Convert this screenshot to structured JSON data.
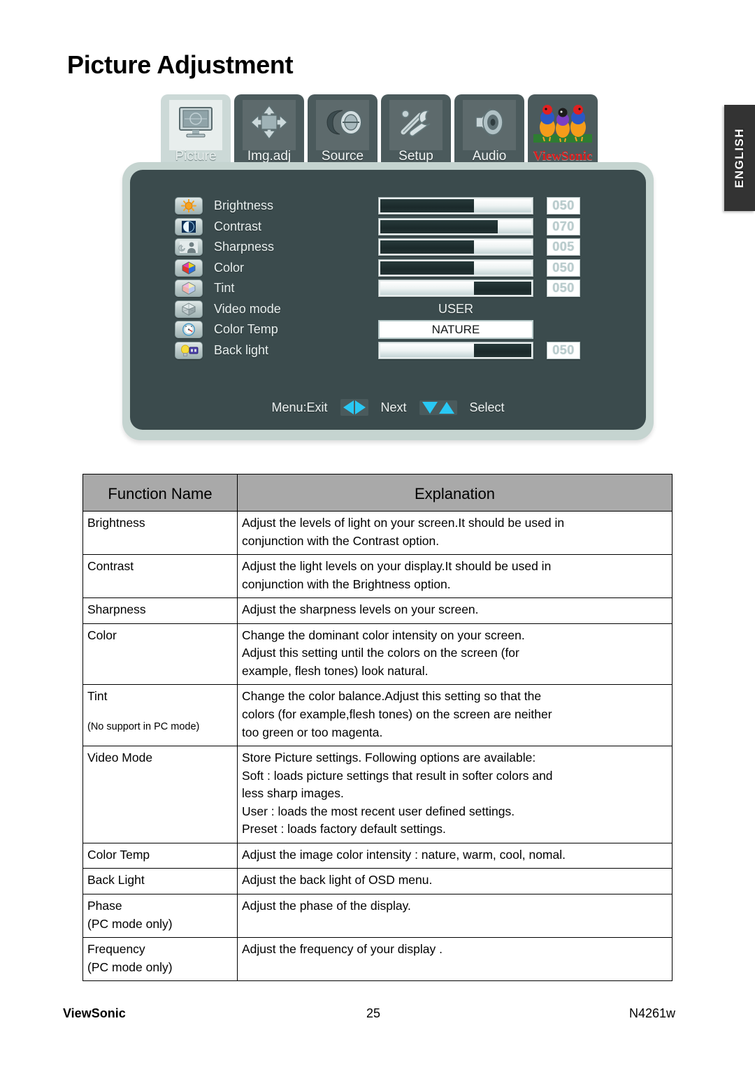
{
  "page": {
    "title": "Picture Adjustment",
    "language_tab": "ENGLISH"
  },
  "osd": {
    "tabs": [
      {
        "label": "Picture",
        "icon": "monitor-icon",
        "active": true
      },
      {
        "label": "Img.adj",
        "icon": "move-arrows-icon",
        "active": false
      },
      {
        "label": "Source",
        "icon": "input-source-icon",
        "active": false
      },
      {
        "label": "Setup",
        "icon": "tools-icon",
        "active": false
      },
      {
        "label": "Audio",
        "icon": "speaker-icon",
        "active": false
      },
      {
        "label": "ViewSonic",
        "icon": "viewsonic-birds-logo",
        "active": false
      }
    ],
    "rows": [
      {
        "label": "Brightness",
        "icon": "sun-icon",
        "value": "050",
        "fill": 62,
        "type": "slider-dark"
      },
      {
        "label": "Contrast",
        "icon": "contrast-icon",
        "value": "070",
        "fill": 78,
        "type": "slider-dark"
      },
      {
        "label": "Sharpness",
        "icon": "person-icon",
        "value": "005",
        "fill": 62,
        "type": "slider-dark"
      },
      {
        "label": "Color",
        "icon": "color-cube-icon",
        "value": "050",
        "fill": 62,
        "type": "slider-dark"
      },
      {
        "label": "Tint",
        "icon": "tint-cube-icon",
        "value": "050",
        "fill": 62,
        "type": "slider-light"
      },
      {
        "label": "Video mode",
        "icon": "gray-cube-icon",
        "value": "USER",
        "type": "text"
      },
      {
        "label": "Color Temp",
        "icon": "gauge-icon",
        "value": "NATURE",
        "type": "combo"
      },
      {
        "label": "Back light",
        "icon": "bulb-icon",
        "value": "050",
        "fill": 62,
        "type": "slider-light"
      }
    ],
    "footer": {
      "exit_label": "Menu:Exit",
      "next_label": "Next",
      "select_label": "Select",
      "lr_keys_icon": "left-right-arrow-keys",
      "ud_keys_icon": "up-down-arrow-keys"
    },
    "accent_color": "#29c8f4",
    "panel_color": "#3b4b4d",
    "shell_color": "#c5d4d0"
  },
  "table": {
    "headers": [
      "Function Name",
      "Explanation"
    ],
    "rows": [
      {
        "name": "Brightness",
        "note": "",
        "lines": [
          "Adjust the levels of light on your screen.It should be used in",
          "conjunction with the Contrast option."
        ]
      },
      {
        "name": "Contrast",
        "note": "",
        "lines": [
          "Adjust the light levels on your display.It should be used in",
          "conjunction with the Brightness option."
        ]
      },
      {
        "name": "Sharpness",
        "note": "",
        "lines": [
          "Adjust the sharpness levels on your screen."
        ]
      },
      {
        "name": "Color",
        "note": "",
        "lines": [
          "Change the dominant color intensity on your screen.",
          "Adjust this setting until the colors on the screen (for",
          "example, flesh tones) look natural."
        ]
      },
      {
        "name": "Tint",
        "note": "(No support in PC mode)",
        "lines": [
          "Change the color balance.Adjust this setting so that the",
          "colors (for example,flesh tones) on the screen are neither",
          "too green or too magenta."
        ]
      },
      {
        "name": "Video Mode",
        "note": "",
        "lines": [
          "Store Picture settings. Following options are available:",
          "Soft : loads picture settings that result in softer colors and",
          "less sharp images.",
          "User :  loads the most recent user defined settings.",
          "Preset :  loads factory default settings."
        ]
      },
      {
        "name": "Color Temp",
        "note": "",
        "lines": [
          "Adjust the image color intensity :  nature, warm, cool, nomal."
        ]
      },
      {
        "name": "Back Light",
        "note": "",
        "lines": [
          "Adjust the back light of OSD menu."
        ]
      },
      {
        "name": "Phase\n(PC mode only)",
        "note": "",
        "lines": [
          "Adjust the phase of the display."
        ]
      },
      {
        "name": "Frequency\n(PC mode only)",
        "note": "",
        "lines": [
          "Adjust the frequency of your display ."
        ]
      }
    ]
  },
  "footer": {
    "brand": "ViewSonic",
    "page_number": "25",
    "model": "N4261w"
  }
}
